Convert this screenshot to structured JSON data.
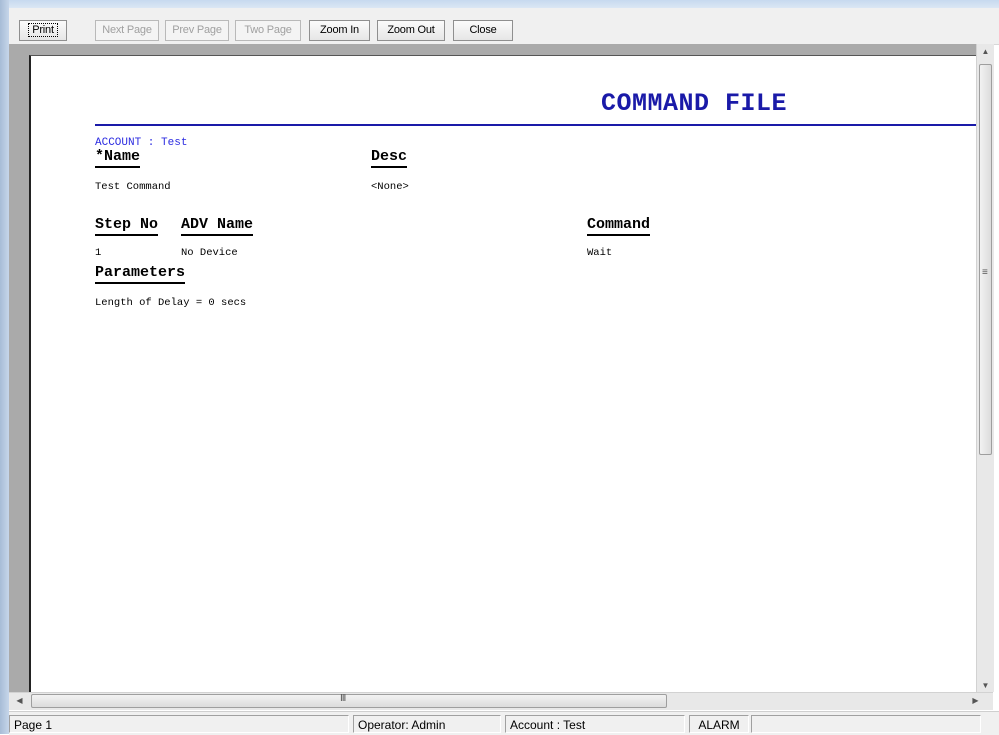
{
  "toolbar": {
    "print": "Print",
    "next_page": "Next Page",
    "prev_page": "Prev Page",
    "two_page": "Two Page",
    "zoom_in": "Zoom In",
    "zoom_out": "Zoom Out",
    "close": "Close"
  },
  "report": {
    "title": "COMMAND FILE",
    "account_line": "ACCOUNT : Test",
    "headers": {
      "name": "*Name",
      "desc": "Desc",
      "step_no": "Step No",
      "adv_name": "ADV Name",
      "command": "Command",
      "parameters": "Parameters"
    },
    "row": {
      "name": "Test Command",
      "desc": "<None>",
      "step_no": "1",
      "adv_name": "No Device",
      "command": "Wait",
      "parameter": "Length of Delay = 0 secs"
    }
  },
  "statusbar": {
    "page": "Page 1",
    "operator": "Operator: Admin",
    "account": "Account : Test",
    "alarm": "ALARM"
  },
  "scrollbar": {
    "h_grip": "III"
  },
  "colors": {
    "title": "#1a1aa8",
    "preview_bg": "#aaaaaa"
  }
}
